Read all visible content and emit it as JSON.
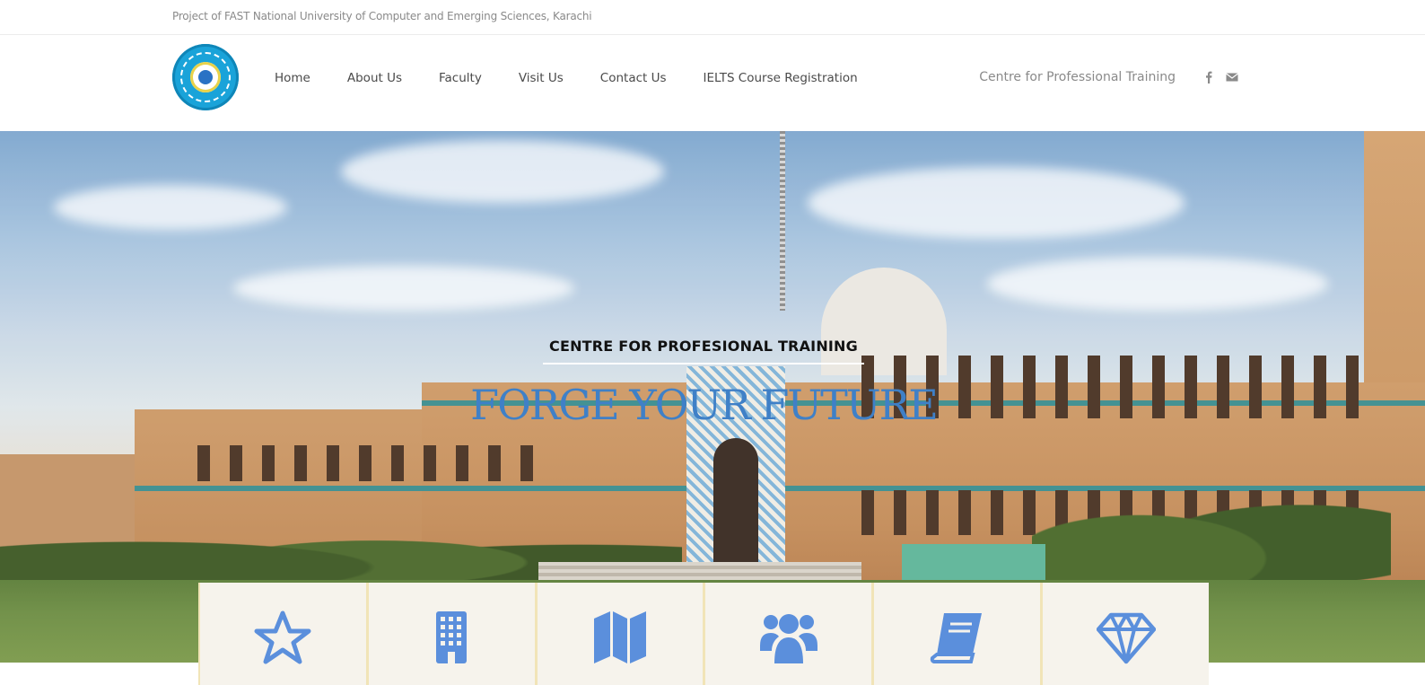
{
  "topbar": {
    "tagline": "Project of FAST National University of Computer and Emerging Sciences, Karachi"
  },
  "header": {
    "logo_icon": "university-seal-logo",
    "nav": [
      {
        "label": "Home"
      },
      {
        "label": "About Us"
      },
      {
        "label": "Faculty"
      },
      {
        "label": "Visit Us"
      },
      {
        "label": "Contact Us"
      },
      {
        "label": "IELTS Course Registration"
      }
    ],
    "site_title": "Centre for Professional Training",
    "social": [
      {
        "icon": "facebook-icon"
      },
      {
        "icon": "envelope-icon"
      }
    ]
  },
  "hero": {
    "kicker": "CENTRE FOR PROFESIONAL TRAINING",
    "title": "FORGE YOUR FUTURE"
  },
  "features": [
    {
      "icon": "star-icon"
    },
    {
      "icon": "building-icon"
    },
    {
      "icon": "map-icon"
    },
    {
      "icon": "users-icon"
    },
    {
      "icon": "book-icon"
    },
    {
      "icon": "diamond-icon"
    }
  ],
  "colors": {
    "accent_blue": "#3f80c7",
    "icon_blue": "#5b8fdc",
    "card_background": "#f6f3ec",
    "card_border": "#f1e4b7",
    "nav_text": "#4a4a4a",
    "muted_text": "#8a8a8a"
  }
}
